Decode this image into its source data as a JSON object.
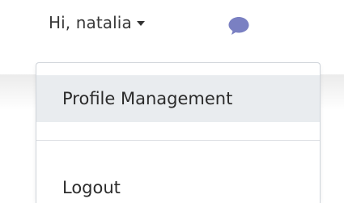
{
  "navbar": {
    "greeting": "Hi, natalia",
    "caret_icon": "caret-down",
    "chat_icon": "chat-bubble",
    "chat_icon_color": "#7a80c2"
  },
  "dropdown": {
    "items": [
      {
        "label": "Profile Management",
        "highlighted": true
      },
      {
        "label": "Logout"
      }
    ],
    "highlight_color": "#e9ecef"
  }
}
